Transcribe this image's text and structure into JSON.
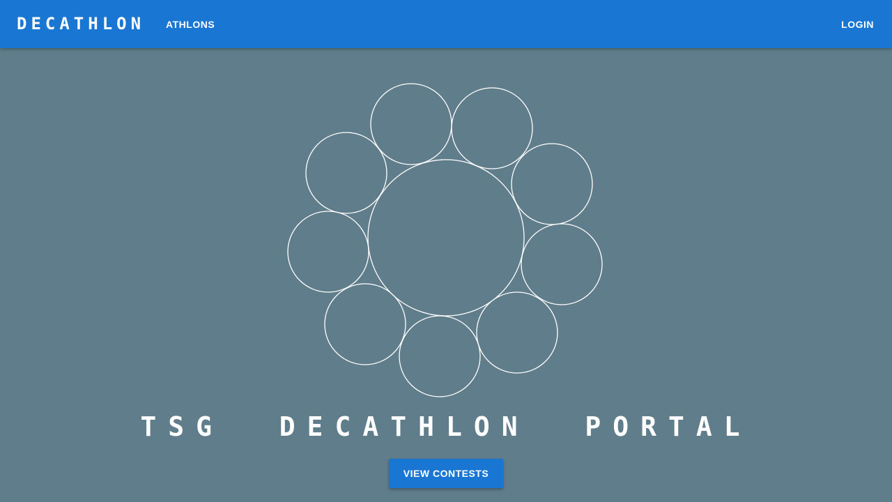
{
  "header": {
    "brand": "DECATHLON",
    "nav_athlons": "ATHLONS",
    "login": "LOGIN"
  },
  "hero": {
    "logo_icon": "ring-of-circles-logo-icon",
    "title": "TSG  DECATHLON  PORTAL",
    "cta_label": "VIEW CONTESTS"
  },
  "colors": {
    "appbar": "#1976d2",
    "background": "#607d8b",
    "button": "#1976d2",
    "text": "#ffffff"
  }
}
